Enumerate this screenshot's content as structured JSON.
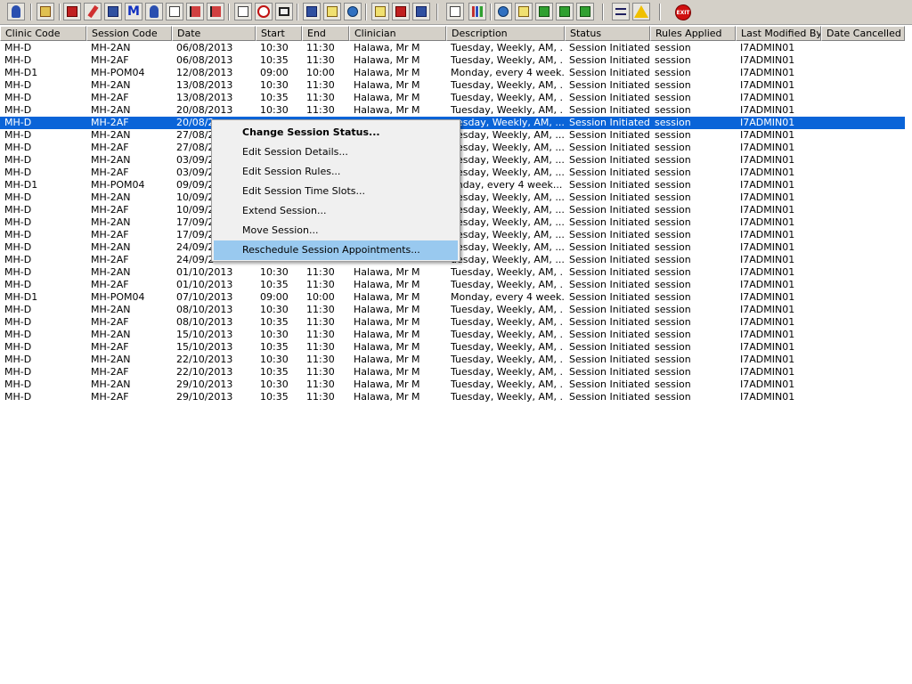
{
  "toolbar": {
    "exit_label": "EXIT"
  },
  "grid": {
    "columns": [
      "Clinic Code",
      "Session Code",
      "Date",
      "Start",
      "End",
      "Clinician",
      "Description",
      "Status",
      "Rules Applied",
      "Last Modified By",
      "Date Cancelled"
    ],
    "rows": [
      [
        "MH-D",
        "MH-2AN",
        "06/08/2013",
        "10:30",
        "11:30",
        "Halawa, Mr M",
        "Tuesday, Weekly, AM, ...",
        "Session Initiated",
        "session",
        "I7ADMIN01",
        ""
      ],
      [
        "MH-D",
        "MH-2AF",
        "06/08/2013",
        "10:35",
        "11:30",
        "Halawa, Mr M",
        "Tuesday, Weekly, AM, ...",
        "Session Initiated",
        "session",
        "I7ADMIN01",
        ""
      ],
      [
        "MH-D1",
        "MH-POM04",
        "12/08/2013",
        "09:00",
        "10:00",
        "Halawa, Mr M",
        "Monday, every 4 week...",
        "Session Initiated",
        "session",
        "I7ADMIN01",
        ""
      ],
      [
        "MH-D",
        "MH-2AN",
        "13/08/2013",
        "10:30",
        "11:30",
        "Halawa, Mr M",
        "Tuesday, Weekly, AM, ...",
        "Session Initiated",
        "session",
        "I7ADMIN01",
        ""
      ],
      [
        "MH-D",
        "MH-2AF",
        "13/08/2013",
        "10:35",
        "11:30",
        "Halawa, Mr M",
        "Tuesday, Weekly, AM, ...",
        "Session Initiated",
        "session",
        "I7ADMIN01",
        ""
      ],
      [
        "MH-D",
        "MH-2AN",
        "20/08/2013",
        "10:30",
        "11:30",
        "Halawa, Mr M",
        "Tuesday, Weekly, AM, ...",
        "Session Initiated",
        "session",
        "I7ADMIN01",
        ""
      ],
      [
        "MH-D",
        "MH-2AF",
        "20/08/2",
        "",
        "",
        "",
        "uesday, Weekly, AM, ...",
        "Session Initiated",
        "session",
        "I7ADMIN01",
        ""
      ],
      [
        "MH-D",
        "MH-2AN",
        "27/08/2",
        "",
        "",
        "",
        "uesday, Weekly, AM, ...",
        "Session Initiated",
        "session",
        "I7ADMIN01",
        ""
      ],
      [
        "MH-D",
        "MH-2AF",
        "27/08/2",
        "",
        "",
        "",
        "uesday, Weekly, AM, ...",
        "Session Initiated",
        "session",
        "I7ADMIN01",
        ""
      ],
      [
        "MH-D",
        "MH-2AN",
        "03/09/2",
        "",
        "",
        "",
        "uesday, Weekly, AM, ...",
        "Session Initiated",
        "session",
        "I7ADMIN01",
        ""
      ],
      [
        "MH-D",
        "MH-2AF",
        "03/09/2",
        "",
        "",
        "",
        "uesday, Weekly, AM, ...",
        "Session Initiated",
        "session",
        "I7ADMIN01",
        ""
      ],
      [
        "MH-D1",
        "MH-POM04",
        "09/09/2",
        "",
        "",
        "",
        "onday, every 4 week...",
        "Session Initiated",
        "session",
        "I7ADMIN01",
        ""
      ],
      [
        "MH-D",
        "MH-2AN",
        "10/09/2",
        "",
        "",
        "",
        "uesday, Weekly, AM, ...",
        "Session Initiated",
        "session",
        "I7ADMIN01",
        ""
      ],
      [
        "MH-D",
        "MH-2AF",
        "10/09/2",
        "",
        "",
        "",
        "uesday, Weekly, AM, ...",
        "Session Initiated",
        "session",
        "I7ADMIN01",
        ""
      ],
      [
        "MH-D",
        "MH-2AN",
        "17/09/2",
        "",
        "",
        "",
        "uesday, Weekly, AM, ...",
        "Session Initiated",
        "session",
        "I7ADMIN01",
        ""
      ],
      [
        "MH-D",
        "MH-2AF",
        "17/09/2",
        "",
        "",
        "",
        "uesday, Weekly, AM, ...",
        "Session Initiated",
        "session",
        "I7ADMIN01",
        ""
      ],
      [
        "MH-D",
        "MH-2AN",
        "24/09/2",
        "",
        "",
        "",
        "uesday, Weekly, AM, ...",
        "Session Initiated",
        "session",
        "I7ADMIN01",
        ""
      ],
      [
        "MH-D",
        "MH-2AF",
        "24/09/2",
        "",
        "",
        "",
        "uesday, Weekly, AM, ...",
        "Session Initiated",
        "session",
        "I7ADMIN01",
        ""
      ],
      [
        "MH-D",
        "MH-2AN",
        "01/10/2013",
        "10:30",
        "11:30",
        "Halawa, Mr M",
        "Tuesday, Weekly, AM, ...",
        "Session Initiated",
        "session",
        "I7ADMIN01",
        ""
      ],
      [
        "MH-D",
        "MH-2AF",
        "01/10/2013",
        "10:35",
        "11:30",
        "Halawa, Mr M",
        "Tuesday, Weekly, AM, ...",
        "Session Initiated",
        "session",
        "I7ADMIN01",
        ""
      ],
      [
        "MH-D1",
        "MH-POM04",
        "07/10/2013",
        "09:00",
        "10:00",
        "Halawa, Mr M",
        "Monday, every 4 week...",
        "Session Initiated",
        "session",
        "I7ADMIN01",
        ""
      ],
      [
        "MH-D",
        "MH-2AN",
        "08/10/2013",
        "10:30",
        "11:30",
        "Halawa, Mr M",
        "Tuesday, Weekly, AM, ...",
        "Session Initiated",
        "session",
        "I7ADMIN01",
        ""
      ],
      [
        "MH-D",
        "MH-2AF",
        "08/10/2013",
        "10:35",
        "11:30",
        "Halawa, Mr M",
        "Tuesday, Weekly, AM, ...",
        "Session Initiated",
        "session",
        "I7ADMIN01",
        ""
      ],
      [
        "MH-D",
        "MH-2AN",
        "15/10/2013",
        "10:30",
        "11:30",
        "Halawa, Mr M",
        "Tuesday, Weekly, AM, ...",
        "Session Initiated",
        "session",
        "I7ADMIN01",
        ""
      ],
      [
        "MH-D",
        "MH-2AF",
        "15/10/2013",
        "10:35",
        "11:30",
        "Halawa, Mr M",
        "Tuesday, Weekly, AM, ...",
        "Session Initiated",
        "session",
        "I7ADMIN01",
        ""
      ],
      [
        "MH-D",
        "MH-2AN",
        "22/10/2013",
        "10:30",
        "11:30",
        "Halawa, Mr M",
        "Tuesday, Weekly, AM, ...",
        "Session Initiated",
        "session",
        "I7ADMIN01",
        ""
      ],
      [
        "MH-D",
        "MH-2AF",
        "22/10/2013",
        "10:35",
        "11:30",
        "Halawa, Mr M",
        "Tuesday, Weekly, AM, ...",
        "Session Initiated",
        "session",
        "I7ADMIN01",
        ""
      ],
      [
        "MH-D",
        "MH-2AN",
        "29/10/2013",
        "10:30",
        "11:30",
        "Halawa, Mr M",
        "Tuesday, Weekly, AM, ...",
        "Session Initiated",
        "session",
        "I7ADMIN01",
        ""
      ],
      [
        "MH-D",
        "MH-2AF",
        "29/10/2013",
        "10:35",
        "11:30",
        "Halawa, Mr M",
        "Tuesday, Weekly, AM, ...",
        "Session Initiated",
        "session",
        "I7ADMIN01",
        ""
      ]
    ],
    "selected_row_index": 6
  },
  "context_menu": {
    "items": [
      {
        "label": "Change Session Status...",
        "default": true
      },
      {
        "label": "Edit Session Details..."
      },
      {
        "label": "Edit Session Rules..."
      },
      {
        "label": "Edit Session Time Slots..."
      },
      {
        "label": "Extend Session..."
      },
      {
        "label": "Move Session..."
      },
      {
        "label": "Reschedule Session Appointments...",
        "highlighted": true
      }
    ]
  },
  "colors": {
    "selection": "#0a64d8",
    "menu_highlight": "#99c9ef",
    "toolbar_bg": "#d4d0c8"
  }
}
